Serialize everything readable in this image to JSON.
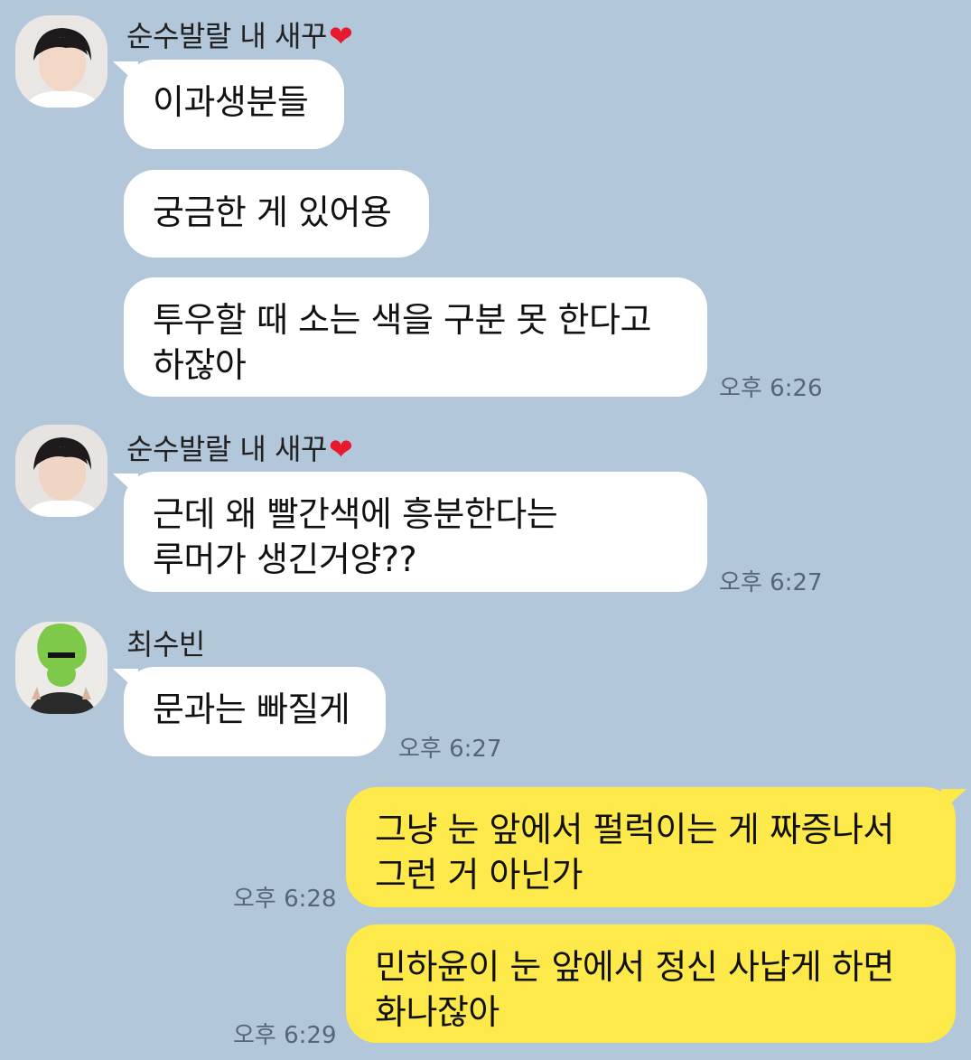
{
  "messages": [
    {
      "sender": "순수발랄 내 새꾸",
      "heart": "❤",
      "lines": [
        "이과생분들"
      ]
    },
    {
      "lines": [
        "궁금한 게 있어용"
      ]
    },
    {
      "lines": [
        "투우할 때 소는 색을 구분 못 한다고",
        "하잖아"
      ],
      "time": "오후 6:26"
    },
    {
      "sender": "순수발랄 내 새꾸",
      "heart": "❤",
      "lines": [
        "근데 왜 빨간색에 흥분한다는",
        "루머가 생긴거양??"
      ],
      "time": "오후 6:27"
    },
    {
      "sender": "최수빈",
      "lines": [
        "문과는 빠질게"
      ],
      "time": "오후 6:27"
    },
    {
      "lines": [
        "그냥 눈 앞에서 펄럭이는 게 짜증나서",
        "그런 거 아닌가"
      ],
      "time": "오후 6:28",
      "mine": true
    },
    {
      "lines": [
        "민하윤이 눈 앞에서 정신 사납게 하면",
        "화나잖아"
      ],
      "time": "오후 6:29",
      "mine": true
    }
  ],
  "colors": {
    "background": "#b2c7d9",
    "incoming_bubble": "#ffffff",
    "outgoing_bubble": "#fee94a",
    "heart": "#e8192c"
  }
}
